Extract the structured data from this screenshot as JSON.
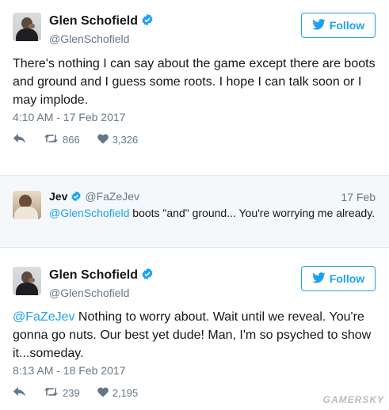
{
  "tweet1": {
    "display_name": "Glen Schofield",
    "handle": "@GlenSchofield",
    "follow_label": "Follow",
    "text": "There's nothing I can say about the game except there are boots and ground and I guess some roots. I hope I can talk soon or I may implode.",
    "timestamp": "4:10 AM - 17 Feb 2017",
    "retweets": "866",
    "likes": "3,326"
  },
  "reply": {
    "display_name": "Jev",
    "handle": "@FaZeJev",
    "date": "17 Feb",
    "mention": "@GlenSchofield",
    "text": " boots \"and\" ground... You're worrying me already."
  },
  "tweet2": {
    "display_name": "Glen Schofield",
    "handle": "@GlenSchofield",
    "follow_label": "Follow",
    "mention": "@FaZeJev",
    "text": " Nothing to worry about. Wait until we reveal. You're gonna go nuts. Our best yet dude! Man, I'm so psyched to show it...someday.",
    "timestamp": "8:13 AM - 18 Feb 2017",
    "retweets": "239",
    "likes": "2,195"
  },
  "watermark": "GAMERSKY",
  "colors": {
    "accent": "#1da1f2",
    "text": "#14171a",
    "muted": "#657786",
    "reply_bg": "#f5f8fa"
  }
}
